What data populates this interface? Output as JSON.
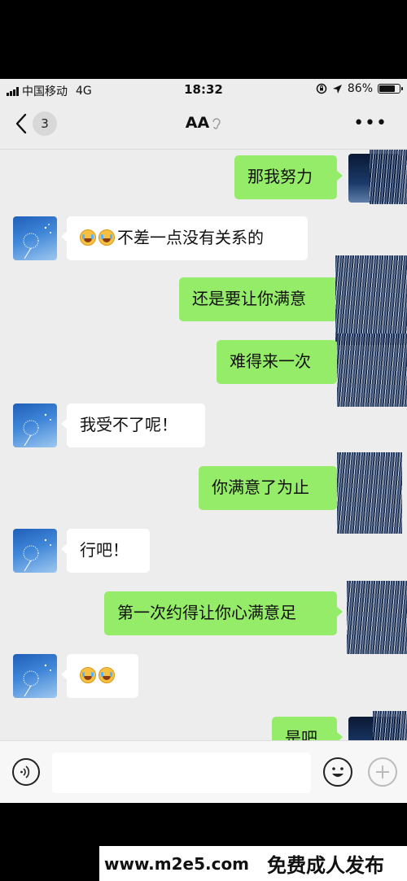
{
  "status_bar": {
    "carrier": "中国移动",
    "network": "4G",
    "time": "18:32",
    "battery_percent": "86%",
    "battery_level": 0.86
  },
  "nav": {
    "back_count": "3",
    "title": "AA",
    "more_icon": "more-dots-icon"
  },
  "messages": [
    {
      "from": "me",
      "text": "那我努力"
    },
    {
      "from": "them",
      "text": "不差一点没有关系的",
      "emoji_prefix_count": 2
    },
    {
      "from": "me",
      "text": "还是要让你满意"
    },
    {
      "from": "me",
      "text": "难得来一次"
    },
    {
      "from": "them",
      "text": "我受不了呢！"
    },
    {
      "from": "me",
      "text": "你满意了为止"
    },
    {
      "from": "them",
      "text": "行吧！"
    },
    {
      "from": "me",
      "text": "第一次约得让你心满意足"
    },
    {
      "from": "them",
      "text": "",
      "emoji_prefix_count": 2
    },
    {
      "from": "me",
      "text": "是吧"
    }
  ],
  "input": {
    "placeholder": "",
    "voice_icon": "voice-icon",
    "emoji_icon": "emoji-icon",
    "plus_icon": "plus-icon"
  },
  "watermark": {
    "url": "www.m2e5.com",
    "text": "免费成人发布"
  },
  "colors": {
    "my_bubble": "#95ec69",
    "their_bubble": "#ffffff",
    "chat_background": "#ededed"
  }
}
